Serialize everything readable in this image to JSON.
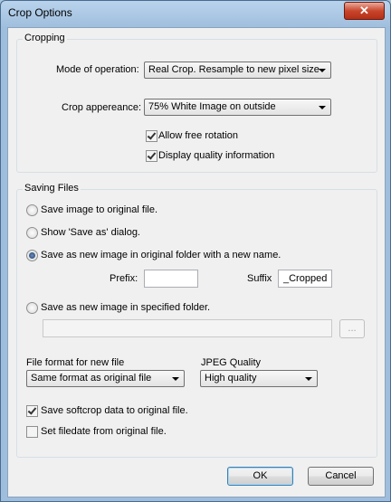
{
  "window": {
    "title": "Crop Options",
    "close_glyph": "✕"
  },
  "cropping": {
    "group_title": "Cropping",
    "mode_label": "Mode of operation:",
    "mode_value": "Real Crop. Resample to new pixel size",
    "appearance_label": "Crop appereance:",
    "appearance_value": "75% White Image on outside",
    "allow_rotation": {
      "label": "Allow free rotation",
      "checked": true
    },
    "quality_info": {
      "label": "Display quality information",
      "checked": true
    }
  },
  "saving": {
    "group_title": "Saving Files",
    "options": [
      {
        "label": "Save image to original file.",
        "selected": false
      },
      {
        "label": "Show 'Save as' dialog.",
        "selected": false
      },
      {
        "label": "Save as new image in original folder with a new name.",
        "selected": true
      },
      {
        "label": "Save as new image in specified folder.",
        "selected": false
      }
    ],
    "prefix_label": "Prefix:",
    "prefix_value": "",
    "suffix_label": "Suffix",
    "suffix_value": "_Cropped",
    "folder_value": "",
    "browse_label": "...",
    "format_label": "File format for new file",
    "format_value": "Same format as original file",
    "jpeg_label": "JPEG Quality",
    "jpeg_value": "High quality",
    "save_softcrop": {
      "label": "Save softcrop data to original file.",
      "checked": true
    },
    "set_filedate": {
      "label": "Set filedate from original file.",
      "checked": false
    }
  },
  "buttons": {
    "ok": "OK",
    "cancel": "Cancel"
  }
}
